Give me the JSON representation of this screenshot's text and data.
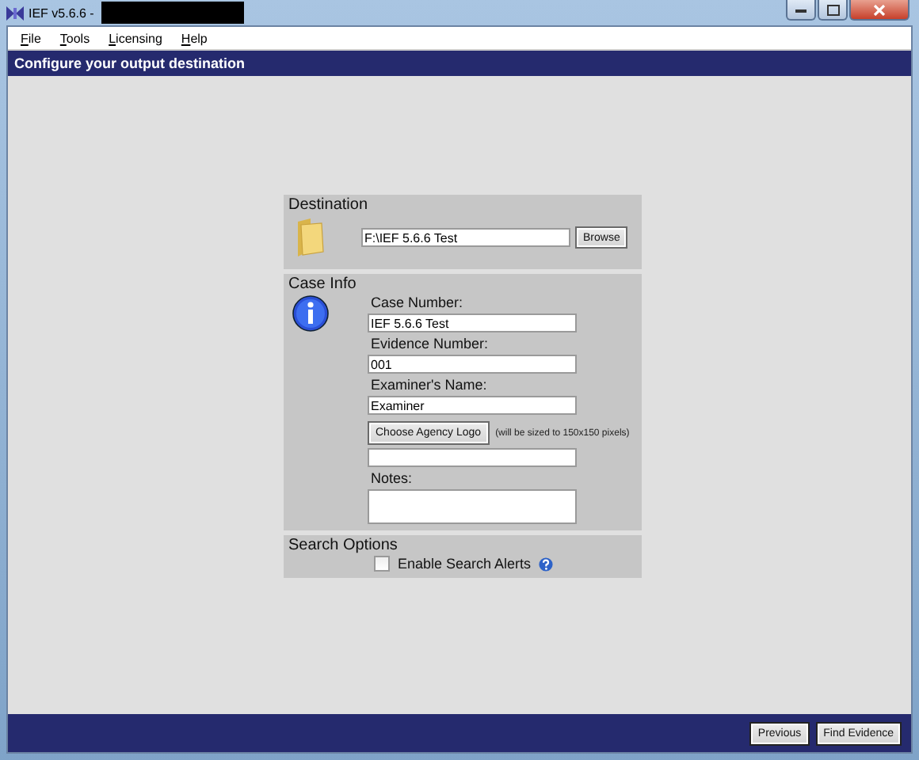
{
  "window": {
    "title": "IEF v5.6.6 -"
  },
  "menu": [
    {
      "label": "File"
    },
    {
      "label": "Tools"
    },
    {
      "label": "Licensing"
    },
    {
      "label": "Help"
    }
  ],
  "header": "Configure your output destination",
  "destination": {
    "title": "Destination",
    "path": "F:\\IEF 5.6.6 Test",
    "browse": "Browse"
  },
  "case_info": {
    "title": "Case Info",
    "fields": [
      {
        "label": "Case Number:",
        "value": "IEF 5.6.6 Test"
      },
      {
        "label": "Evidence Number:",
        "value": "001"
      },
      {
        "label": "Examiner's Name:",
        "value": "Examiner"
      }
    ],
    "logo_button": "Choose Agency Logo",
    "logo_hint": "(will be sized to 150x150 pixels)",
    "notes_label": "Notes:"
  },
  "search_options": {
    "title": "Search Options",
    "alert": {
      "label": "Enable Search Alerts",
      "checked": false
    }
  },
  "footer": {
    "buttons": [
      {
        "label": "Previous"
      },
      {
        "label": "Find Evidence"
      }
    ]
  }
}
